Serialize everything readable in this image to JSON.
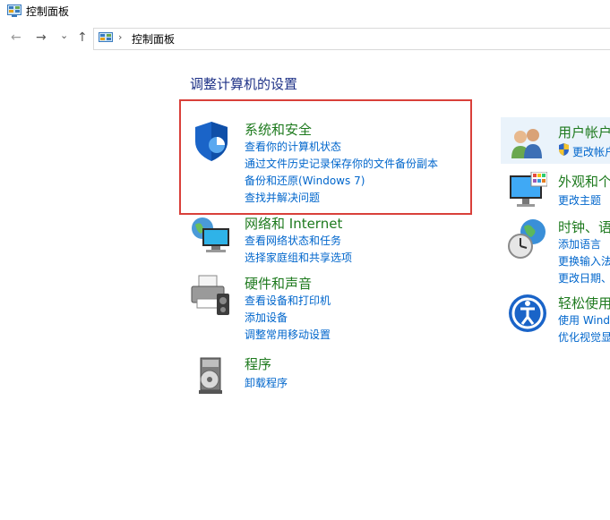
{
  "window": {
    "title": "控制面板"
  },
  "nav": {
    "back_glyph": "←",
    "forward_glyph": "→",
    "recent_glyph": "⌄",
    "up_glyph": "↑",
    "crumb_sep": "›",
    "breadcrumb": "控制面板"
  },
  "heading": "调整计算机的设置",
  "categories": [
    {
      "title": "系统和安全",
      "icon": "shield-icon",
      "links": [
        "查看你的计算机状态",
        "通过文件历史记录保存你的文件备份副本",
        "备份和还原(Windows 7)",
        "查找并解决问题"
      ]
    },
    {
      "title": "网络和 Internet",
      "icon": "network-icon",
      "links": [
        "查看网络状态和任务",
        "选择家庭组和共享选项"
      ]
    },
    {
      "title": "硬件和声音",
      "icon": "printer-icon",
      "links": [
        "查看设备和打印机",
        "添加设备",
        "调整常用移动设置"
      ]
    },
    {
      "title": "程序",
      "icon": "programs-icon",
      "links": [
        "卸载程序"
      ]
    }
  ],
  "right_categories": [
    {
      "title": "用户帐户",
      "icon": "users-icon",
      "links": [
        "更改帐户"
      ]
    },
    {
      "title": "外观和个",
      "icon": "appearance-icon",
      "links": [
        "更改主题"
      ]
    },
    {
      "title": "时钟、语",
      "icon": "clock-globe-icon",
      "links": [
        "添加语言",
        "更换输入法",
        "更改日期、"
      ]
    },
    {
      "title": "轻松使用",
      "icon": "ease-of-access-icon",
      "links": [
        "使用 Wind",
        "优化视觉显"
      ]
    }
  ],
  "colors": {
    "category_title": "#1e7a1e",
    "link": "#0066cc",
    "heading": "#1e3287",
    "highlight_box": "#d9403a"
  }
}
